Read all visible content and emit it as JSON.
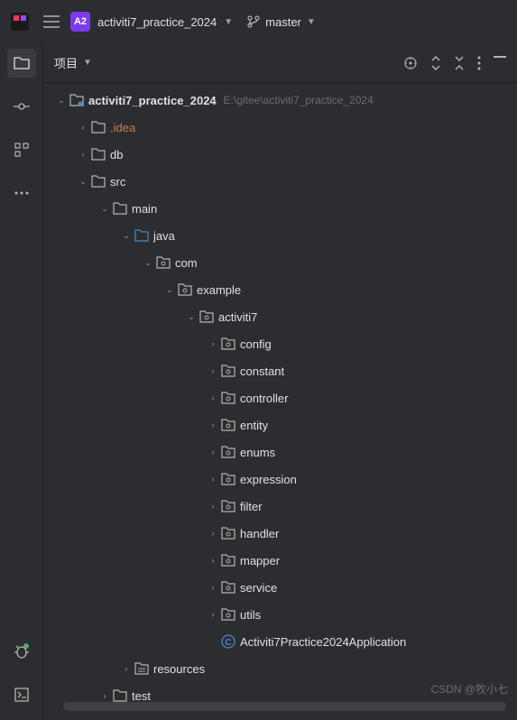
{
  "topbar": {
    "project_badge": "A2",
    "project_name": "activiti7_practice_2024",
    "branch": "master"
  },
  "panel": {
    "title": "项目"
  },
  "tree": {
    "root": {
      "name": "activiti7_practice_2024",
      "path": "E:\\gitee\\activiti7_practice_2024"
    },
    "idea": ".idea",
    "db": "db",
    "src": "src",
    "main": "main",
    "java": "java",
    "com": "com",
    "example": "example",
    "activiti7": "activiti7",
    "pkgs": [
      "config",
      "constant",
      "controller",
      "entity",
      "enums",
      "expression",
      "filter",
      "handler",
      "mapper",
      "service",
      "utils"
    ],
    "app_class": "Activiti7Practice2024Application",
    "resources": "resources",
    "test": "test"
  },
  "watermark": "CSDN @牧小七"
}
